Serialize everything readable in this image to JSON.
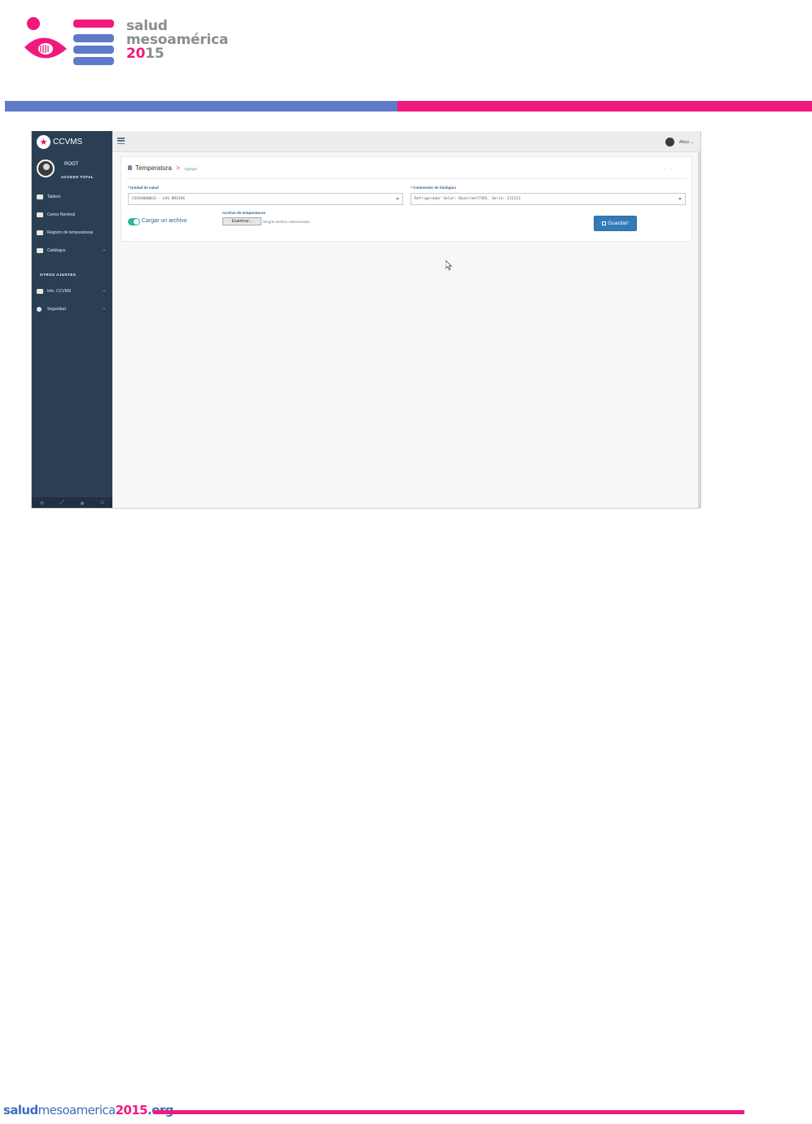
{
  "colors": {
    "pink": "#ef1a7c",
    "blue": "#5f7ac8",
    "sidebar": "#2a3f54",
    "button": "#337ab7",
    "toggle": "#26b99a"
  },
  "header": {
    "logo_line1": "salud",
    "logo_line2": "mesoamérica",
    "logo_year_a": "20",
    "logo_year_b": "15"
  },
  "app": {
    "brand": "CCVMS",
    "profile": {
      "name": "ROOT",
      "role": "ACCESO TOTAL"
    },
    "menu": [
      {
        "label": "Tablero",
        "icon": "dashboard-icon"
      },
      {
        "label": "Censo Nominal",
        "icon": "users-icon"
      },
      {
        "label": "Registro de temperaturas",
        "icon": "thermometer-icon"
      },
      {
        "label": "Catálogos",
        "icon": "book-icon"
      }
    ],
    "section_title": "OTROS AJUSTES",
    "menu2": [
      {
        "label": "Info. CCVMS",
        "icon": "info-card-icon"
      },
      {
        "label": "Seguridad",
        "icon": "shield-icon"
      }
    ],
    "topnav_user": "Albey"
  },
  "form": {
    "title": "Temperatura",
    "separator": ">",
    "subtitle": "Agregar",
    "unidad_label": "* Unidad de salud",
    "unidad_value": "CSSSA000033 - LAS BRISAS",
    "contenedor_label": "* Contenedor de biológico",
    "contenedor_value": "Refrigerador Solar: Bazor/mof7365. Serie: 211222",
    "toggle_label": "Cargar un archivo",
    "file_label": "Archivo de temperaturas",
    "file_button": "Examinar...",
    "file_none": "Ningún archivo seleccionado.",
    "save_button": "Guardar!"
  },
  "footer": {
    "a": "salud",
    "b": "mesoamerica",
    "c": "2015",
    "d": ".org"
  }
}
